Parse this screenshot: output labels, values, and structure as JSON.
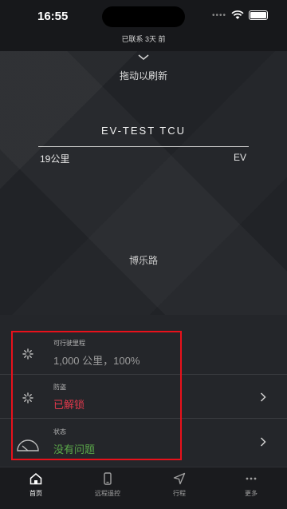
{
  "status_bar": {
    "time": "16:55"
  },
  "connection": {
    "text": "已联系 3天 前"
  },
  "hero": {
    "pull_to_refresh": "拖动以刷新",
    "vehicle_name": "EV-TEST TCU",
    "range": "19公里",
    "powertrain": "EV",
    "location": "博乐路"
  },
  "status_panel": {
    "rows": [
      {
        "label": "可行驶里程",
        "value": "1,000 公里，100%",
        "icon": "loading-spinner-icon",
        "color": "#9d9d9d"
      },
      {
        "label": "防盗",
        "value": "已解锁",
        "icon": "loading-spinner-icon",
        "color": "#e2394c"
      },
      {
        "label": "状态",
        "value": "没有问题",
        "icon": "gauge-icon",
        "color": "#5ba84a"
      }
    ],
    "highlight_color": "#e8111b"
  },
  "tabbar": {
    "tabs": [
      {
        "label": "首页",
        "icon": "home-icon",
        "active": true
      },
      {
        "label": "远程遥控",
        "icon": "phone-icon",
        "active": false
      },
      {
        "label": "行程",
        "icon": "navigation-arrow-icon",
        "active": false
      },
      {
        "label": "更多",
        "icon": "more-icon",
        "active": false
      }
    ]
  }
}
